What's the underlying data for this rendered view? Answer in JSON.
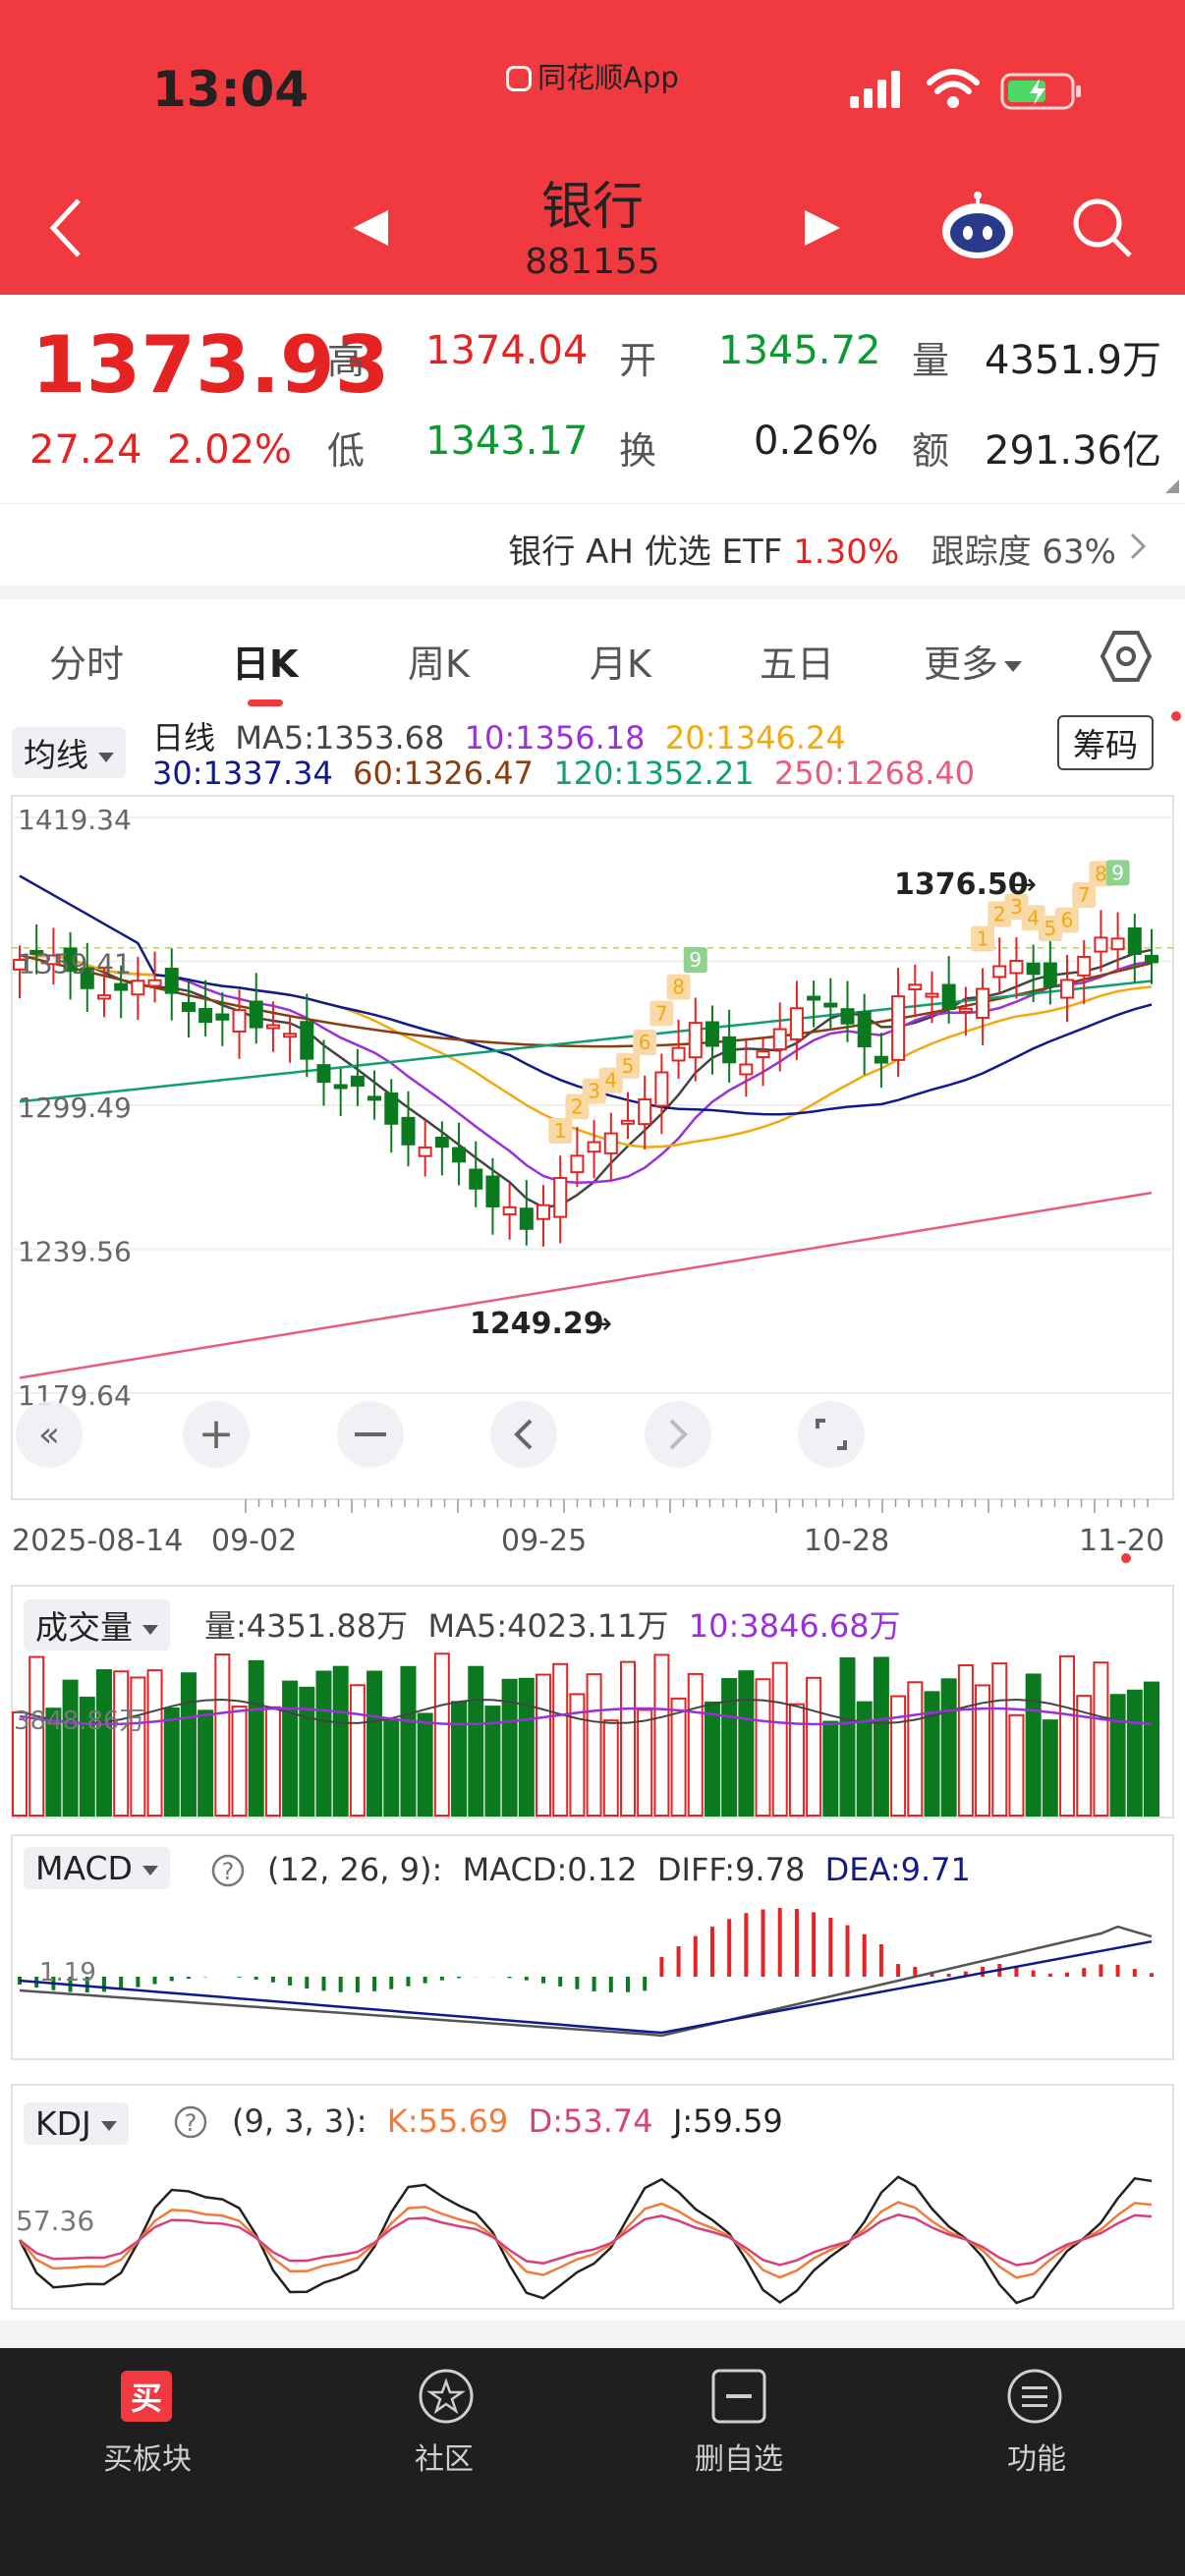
{
  "status": {
    "time": "13:04",
    "app": "同花顺App"
  },
  "header": {
    "title": "银行",
    "code": "881155"
  },
  "quote": {
    "price": "1373.93",
    "change": "27.24",
    "change_pct": "2.02%",
    "high_label": "高",
    "high": "1374.04",
    "open_label": "开",
    "open": "1345.72",
    "vol_label": "量",
    "vol": "4351.9万",
    "low_label": "低",
    "low": "1343.17",
    "turnover_label": "换",
    "turnover": "0.26%",
    "amount_label": "额",
    "amount": "291.36亿"
  },
  "etf": {
    "name": "银行 AH 优选 ETF",
    "pct": "1.30%",
    "track_label": "跟踪度",
    "track": "63%"
  },
  "tabs": [
    "分时",
    "日K",
    "周K",
    "月K",
    "五日",
    "更多"
  ],
  "ma": {
    "selector": "均线",
    "line": "日线",
    "ma5": "MA5:1353.68",
    "ma10": "10:1356.18",
    "ma20": "20:1346.24",
    "ma30": "30:1337.34",
    "ma60": "60:1326.47",
    "ma120": "120:1352.21",
    "ma250": "250:1268.40",
    "chip_btn": "筹码"
  },
  "colors": {
    "header": "#f03a3f",
    "up": "#e62323",
    "down": "#0b7a1f",
    "ma5": "#444444",
    "ma10": "#9b30d9",
    "ma20": "#f2a90f",
    "ma30": "#101a8c",
    "ma60": "#8a3d10",
    "ma120": "#10a070",
    "ma250": "#e85b7a"
  },
  "chart_data": [
    {
      "type": "candlestick",
      "y_ticks": [
        "1419.34",
        "1359.41",
        "1299.49",
        "1239.56",
        "1179.64"
      ],
      "ylim": [
        1179.64,
        1419.34
      ],
      "x_ticks": [
        "2025-08-14",
        "09-02",
        "09-25",
        "10-28",
        "11-20"
      ],
      "annotations": {
        "high": "1376.50",
        "low": "1249.29"
      },
      "td_numbers": [
        "1",
        "2",
        "3",
        "4",
        "5",
        "6",
        "7",
        "8",
        "9"
      ]
    },
    {
      "type": "bar",
      "title": "成交量",
      "info": {
        "vol": "量:4351.88万",
        "ma5": "MA5:4023.11万",
        "ma10": "10:3846.68万"
      },
      "y_tick": "3848.86万"
    },
    {
      "type": "bar",
      "title": "MACD",
      "info": {
        "params": "(12, 26, 9):",
        "macd": "MACD:0.12",
        "diff": "DIFF:9.78",
        "dea": "DEA:9.71"
      },
      "y_tick": "1.19"
    },
    {
      "type": "line",
      "title": "KDJ",
      "info": {
        "params": "(9, 3, 3):",
        "k": "K:55.69",
        "d": "D:53.74",
        "j": "J:59.59"
      },
      "y_tick": "57.36"
    }
  ],
  "bottom_nav": [
    "买板块",
    "社区",
    "删自选",
    "功能"
  ]
}
